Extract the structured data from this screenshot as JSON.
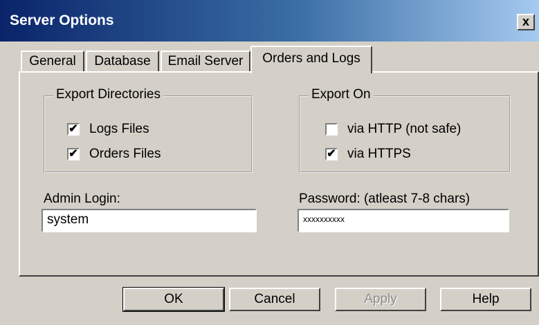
{
  "window": {
    "title": "Server Options",
    "close_label": "x"
  },
  "tabs": [
    {
      "label": "General"
    },
    {
      "label": "Database"
    },
    {
      "label": "Email Server"
    },
    {
      "label": "Orders and Logs",
      "active": true
    }
  ],
  "export_directories": {
    "title": "Export Directories",
    "items": [
      {
        "label": "Logs Files",
        "checked": true
      },
      {
        "label": "Orders Files",
        "checked": true
      }
    ]
  },
  "export_on": {
    "title": "Export On",
    "items": [
      {
        "label": "via HTTP (not safe)",
        "checked": false
      },
      {
        "label": "via HTTPS",
        "checked": true
      }
    ]
  },
  "admin_login": {
    "label": "Admin Login:",
    "value": "system"
  },
  "password": {
    "label": "Password: (atleast 7-8 chars)",
    "value": "xxxxxxxxxx"
  },
  "buttons": {
    "ok": "OK",
    "cancel": "Cancel",
    "apply": "Apply",
    "help": "Help"
  },
  "check_mark": "✔"
}
